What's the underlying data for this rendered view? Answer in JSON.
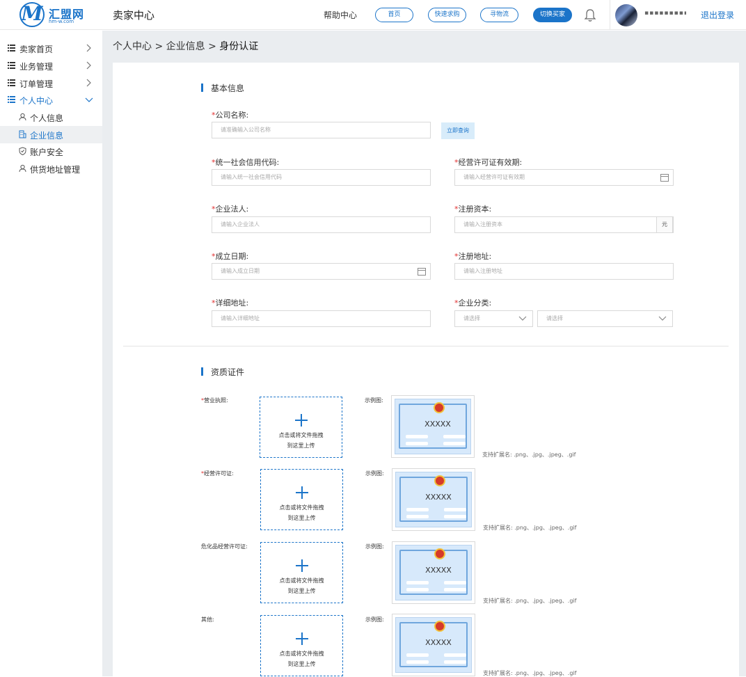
{
  "header": {
    "logo_text": "汇盟网",
    "logo_sub": "hm-w.com",
    "logo_mark": "M",
    "app_title": "卖家中心",
    "help": "帮助中心",
    "nav_buttons": [
      "首页",
      "快速求购",
      "寻物流",
      "切换买家"
    ],
    "username": "▪▪▪▪▪▪▪▪▪",
    "logout": "退出登录",
    "icons": {
      "bell": "bell-icon",
      "avatar": "user-avatar"
    }
  },
  "sidebar": {
    "menu": [
      {
        "label": "卖家首页",
        "icon": "list-icon",
        "chevron": "chevron-right-icon"
      },
      {
        "label": "业务管理",
        "icon": "list-icon",
        "chevron": "chevron-right-icon"
      },
      {
        "label": "订单管理",
        "icon": "list-icon",
        "chevron": "chevron-right-icon"
      },
      {
        "label": "个人中心",
        "icon": "list-icon",
        "chevron": "chevron-down-icon"
      }
    ],
    "submenu": [
      {
        "label": "个人信息",
        "icon": "user-icon"
      },
      {
        "label": "企业信息",
        "icon": "building-icon"
      },
      {
        "label": "账户安全",
        "icon": "shield-icon"
      },
      {
        "label": "供货地址管理",
        "icon": "user-icon"
      }
    ]
  },
  "breadcrumb": {
    "path": "个人中心 > 企业信息 > ",
    "current": "身份认证"
  },
  "basic": {
    "title": "基本信息",
    "company_name": {
      "label": "公司名称:",
      "placeholder": "请准确输入公司名称"
    },
    "query_button": "立即查询",
    "credit_code": {
      "label": "统一社会信用代码:",
      "placeholder": "请输入统一社会信用代码"
    },
    "license_valid": {
      "label": "经营许可证有效期:",
      "placeholder": "请输入经营许可证有效期"
    },
    "legal_person": {
      "label": "企业法人:",
      "placeholder": "请输入企业法人"
    },
    "reg_capital": {
      "label": "注册资本:",
      "placeholder": "请输入注册资本",
      "unit": "元"
    },
    "found_date": {
      "label": "成立日期:",
      "placeholder": "请输入成立日期"
    },
    "reg_address": {
      "label": "注册地址:",
      "placeholder": "请输入注册地址"
    },
    "detail_address": {
      "label": "详细地址:",
      "placeholder": "请输入详细地址"
    },
    "category": {
      "label": "企业分类:",
      "placeholder1": "请选择",
      "placeholder2": "请选择"
    },
    "required_mark": "*"
  },
  "qualification": {
    "title": "资质证件",
    "example_label": "示例图:",
    "upload_line1": "点击或将文件拖拽",
    "upload_line2": "到这里上传",
    "sample_text": "XXXXX",
    "ext_note": "支持扩展名: .png、.jpg、.jpeg、.gif",
    "items": [
      {
        "label": "营业执照:",
        "required": true
      },
      {
        "label": "经营许可证:",
        "required": true
      },
      {
        "label": "危化品经营许可证:",
        "required": false
      },
      {
        "label": "其他:",
        "required": false
      }
    ]
  },
  "colors": {
    "accent": "#1b74c9",
    "required": "#e02d2d",
    "content_bg": "#eaedf0"
  }
}
